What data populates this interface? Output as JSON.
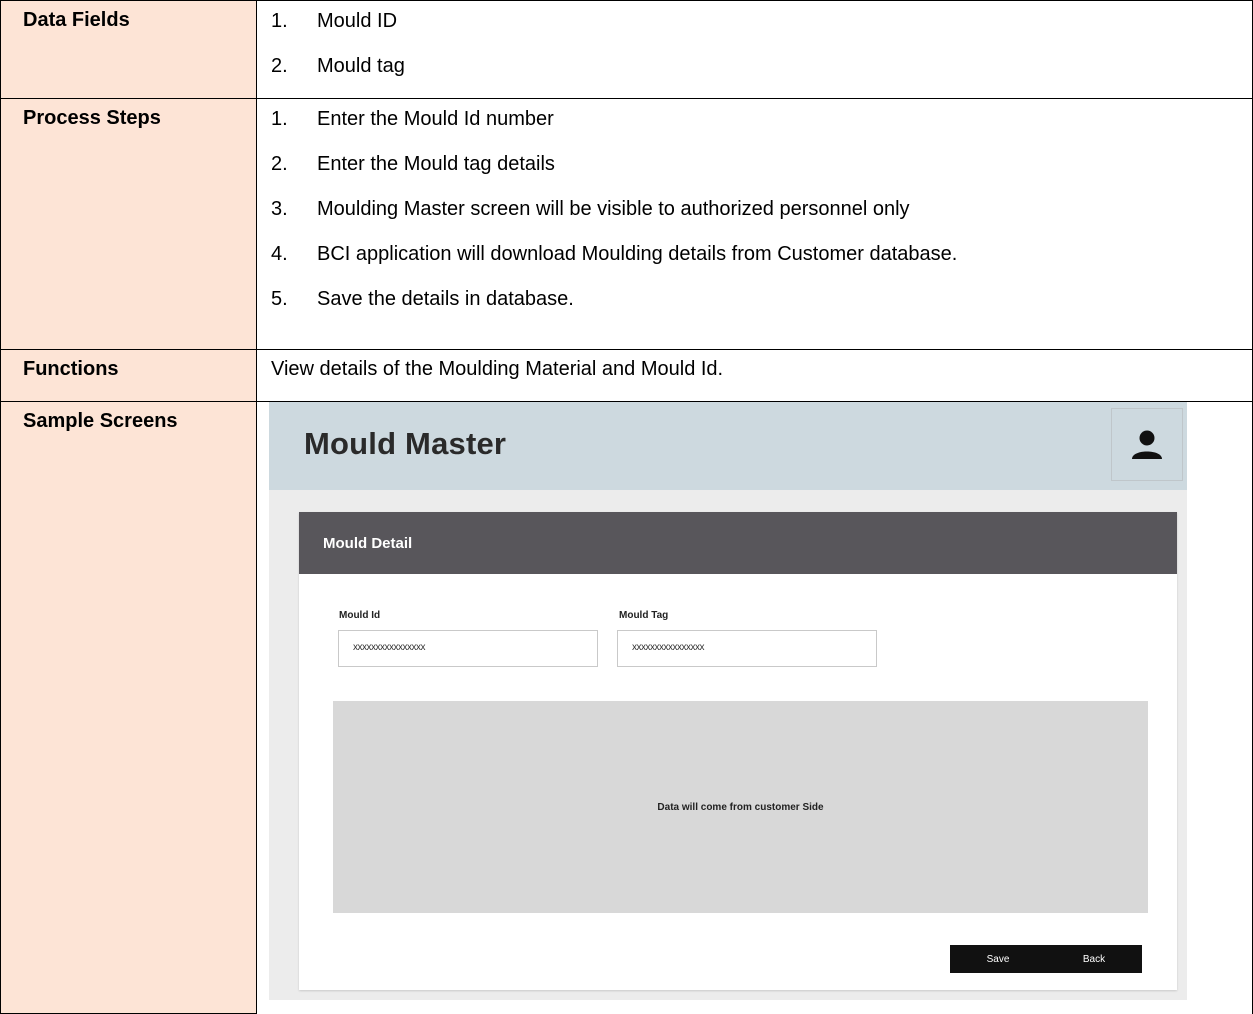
{
  "rows": {
    "data_fields": {
      "label": "Data Fields",
      "items": [
        {
          "num": "1.",
          "text": "Mould ID"
        },
        {
          "num": "2.",
          "text": "Mould tag"
        }
      ]
    },
    "process_steps": {
      "label": "Process Steps",
      "items": [
        {
          "num": "1.",
          "text": "Enter the Mould Id number"
        },
        {
          "num": "2.",
          "text": "Enter the Mould tag details"
        },
        {
          "num": "3.",
          "text": "Moulding Master screen will be visible to authorized personnel only"
        },
        {
          "num": "4.",
          "text": "BCI application will download Moulding details from Customer database."
        },
        {
          "num": "5.",
          "text": "Save the details in database."
        }
      ]
    },
    "functions": {
      "label": "Functions",
      "text": "View details of the Moulding Material and Mould Id."
    },
    "sample_screens": {
      "label": "Sample Screens"
    }
  },
  "screen": {
    "title": "Mould Master",
    "user_icon": "user-icon",
    "card_title": "Mould Detail",
    "mould_id_label": "Mould Id",
    "mould_id_value": "xxxxxxxxxxxxxxxx",
    "mould_tag_label": "Mould Tag",
    "mould_tag_value": "xxxxxxxxxxxxxxxx",
    "data_panel_text": "Data will come from customer Side",
    "save_label": "Save",
    "back_label": "Back"
  },
  "colors": {
    "label_bg": "#fde4d6",
    "screen_header_bg": "#cdd9df",
    "card_header_bg": "#58565b",
    "data_panel_bg": "#d8d8d8",
    "button_bg": "#111111"
  }
}
